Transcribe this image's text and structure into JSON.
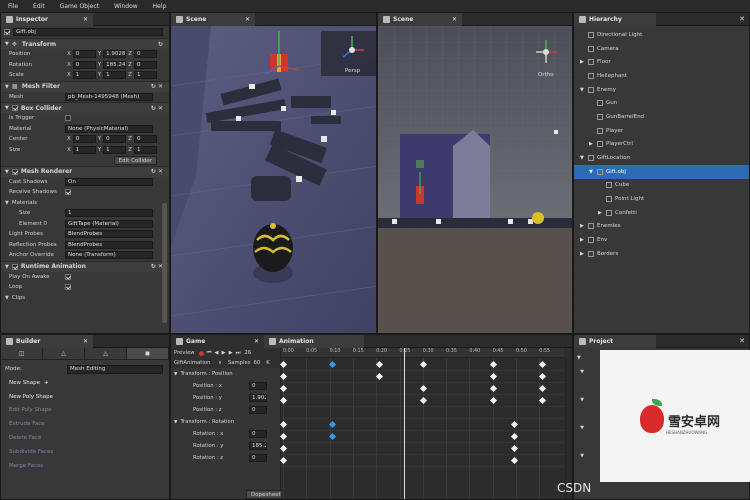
{
  "menu": [
    "File",
    "Edit",
    "Game Object",
    "Window",
    "Help"
  ],
  "inspector": {
    "tab": "Inspector",
    "object_name": "Gift.obj",
    "transform": {
      "title": "Transform",
      "rows": [
        {
          "label": "Position",
          "x": "0",
          "y": "1.90281",
          "z": "0"
        },
        {
          "label": "Rotation",
          "x": "0",
          "y": "185.241",
          "z": "0"
        },
        {
          "label": "Scale",
          "x": "1",
          "y": "1",
          "z": "1"
        }
      ]
    },
    "mesh_filter": {
      "title": "Mesh Filter",
      "mesh_label": "Mesh",
      "mesh_value": "pb_Mesh-1495948 (Mesh)"
    },
    "box_collider": {
      "title": "Box Collider",
      "is_trigger": "Is Trigger",
      "material_label": "Material",
      "material_value": "None (PhysicMaterial)",
      "center": {
        "label": "Center",
        "x": "0",
        "y": "0",
        "z": "0"
      },
      "size": {
        "label": "Size",
        "x": "1",
        "y": "1",
        "z": "1"
      },
      "edit_button": "Edit Collider"
    },
    "mesh_renderer": {
      "title": "Mesh Renderer",
      "cast_label": "Cast Shadows",
      "cast_value": "On",
      "receive_label": "Receive Shadows",
      "materials_label": "Materials",
      "size_label": "Size",
      "size_value": "1",
      "element_label": "Element 0",
      "element_value": "GiftTape (Material)",
      "light_label": "Light Probes",
      "light_value": "BlendProbes",
      "reflection_label": "Reflection Probes",
      "reflection_value": "BlendProbes",
      "anchor_label": "Anchor Override",
      "anchor_value": "None (Transform)"
    },
    "runtime_animation": {
      "title": "Runtime Animation",
      "play_label": "Play On Awake",
      "loop_label": "Loop",
      "clips_label": "Clips"
    }
  },
  "scene1": {
    "tab": "Scene",
    "gizmo_label": "Persp"
  },
  "scene2": {
    "tab": "Scene",
    "gizmo_label": "Ortho"
  },
  "hierarchy": {
    "tab": "Hierarchy",
    "items": [
      {
        "label": "Directional Light",
        "indent": 0,
        "arrow": ""
      },
      {
        "label": "Camera",
        "indent": 0,
        "arrow": ""
      },
      {
        "label": "Floor",
        "indent": 0,
        "arrow": "▶"
      },
      {
        "label": "Hellephant",
        "indent": 0,
        "arrow": ""
      },
      {
        "label": "Enemy",
        "indent": 0,
        "arrow": "▼"
      },
      {
        "label": "Gun",
        "indent": 1,
        "arrow": ""
      },
      {
        "label": "GunBarrelEnd",
        "indent": 1,
        "arrow": ""
      },
      {
        "label": "Player",
        "indent": 1,
        "arrow": ""
      },
      {
        "label": "PlayerCtrl",
        "indent": 1,
        "arrow": "▶"
      },
      {
        "label": "GiftLocation",
        "indent": 0,
        "arrow": "▼"
      },
      {
        "label": "Gift.obj",
        "indent": 1,
        "arrow": "▼",
        "selected": true
      },
      {
        "label": "Cube",
        "indent": 2,
        "arrow": ""
      },
      {
        "label": "Point Light",
        "indent": 2,
        "arrow": ""
      },
      {
        "label": "Confetti",
        "indent": 2,
        "arrow": "▶"
      },
      {
        "label": "Enemies",
        "indent": 0,
        "arrow": "▶"
      },
      {
        "label": "Env",
        "indent": 0,
        "arrow": "▶"
      },
      {
        "label": "Borders",
        "indent": 0,
        "arrow": "▶"
      }
    ]
  },
  "builder": {
    "tab": "Builder",
    "mode_label": "Mode:",
    "mode_value": "Mesh Editing",
    "items": [
      {
        "label": "New Shape",
        "state": "on",
        "plus": "+"
      },
      {
        "label": "New Poly Shape",
        "state": "on",
        "plus": ""
      },
      {
        "label": "Edit Poly Shape",
        "state": "off",
        "plus": ""
      },
      {
        "label": "Extrude Face",
        "state": "off",
        "plus": ""
      },
      {
        "label": "Delete Face",
        "state": "off",
        "plus": ""
      },
      {
        "label": "Subdivide Faces",
        "state": "off",
        "plus": ""
      },
      {
        "label": "Merge Faces",
        "state": "off",
        "plus": ""
      }
    ]
  },
  "game": {
    "tab": "Game"
  },
  "animation": {
    "tab": "Animation",
    "preview": "Preview",
    "frame": "26",
    "clip": "GiftAnimation",
    "samples_label": "Samples",
    "samples_value": "60",
    "k": "K",
    "times": [
      "0:00",
      "0:05",
      "0:10",
      "0:15",
      "0:20",
      "0:25",
      "0:30",
      "0:35",
      "0:40",
      "0:45",
      "0:50",
      "0:55"
    ],
    "rows": [
      {
        "label": "Transform : Position",
        "value": "",
        "group": true
      },
      {
        "label": "Position : x",
        "value": "0",
        "group": false
      },
      {
        "label": "Position : y",
        "value": "1.9028",
        "group": false
      },
      {
        "label": "Position : z",
        "value": "0",
        "group": false
      },
      {
        "label": "Transform : Rotation",
        "value": "",
        "group": true
      },
      {
        "label": "Rotation : x",
        "value": "0",
        "group": false
      },
      {
        "label": "Rotation : y",
        "value": "185.2",
        "group": false
      },
      {
        "label": "Rotation : z",
        "value": "0",
        "group": false
      }
    ],
    "mode_button": "Dopesheet"
  },
  "project": {
    "tab": "Project"
  },
  "watermark": {
    "csdn": "CSDN",
    "site_cn": "雪安卓网",
    "site_en": "HESHANZHUOWANG"
  }
}
